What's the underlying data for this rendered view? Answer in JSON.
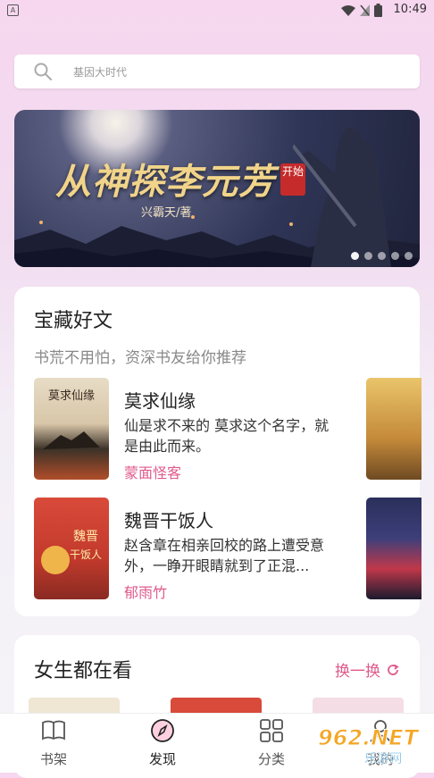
{
  "status_bar": {
    "time": "10:49",
    "sim_label": "A"
  },
  "search": {
    "placeholder": "基因大时代"
  },
  "banner": {
    "title": "从神探李元芳",
    "seal": "开始",
    "author": "兴霸天/著",
    "slide_count": 5,
    "active_slide": 1
  },
  "treasure": {
    "heading": "宝藏好文",
    "subtitle": "书荒不用怕，资深书友给你推荐",
    "books": [
      {
        "title": "莫求仙缘",
        "desc": "仙是求不来的 莫求这个名字，就是由此而来。",
        "author": "蒙面怪客",
        "cover_text": "莫求仙缘"
      },
      {
        "title": "魏晋干饭人",
        "desc": "赵含章在相亲回校的路上遭受意外，一睁开眼睛就到了正混...",
        "author": "郁雨竹",
        "cover_text": "魏晋干饭人"
      }
    ]
  },
  "girls": {
    "heading": "女生都在看",
    "refresh_label": "换一换"
  },
  "tabs": [
    {
      "label": "书架",
      "icon": "book-icon"
    },
    {
      "label": "发现",
      "icon": "compass-icon"
    },
    {
      "label": "分类",
      "icon": "grid-icon"
    },
    {
      "label": "我的",
      "icon": "person-icon"
    }
  ],
  "watermark": {
    "text": "962.NET",
    "sub": "乐游网"
  },
  "colors": {
    "accent": "#e05a8a",
    "background_top": "#f6d7ef"
  }
}
